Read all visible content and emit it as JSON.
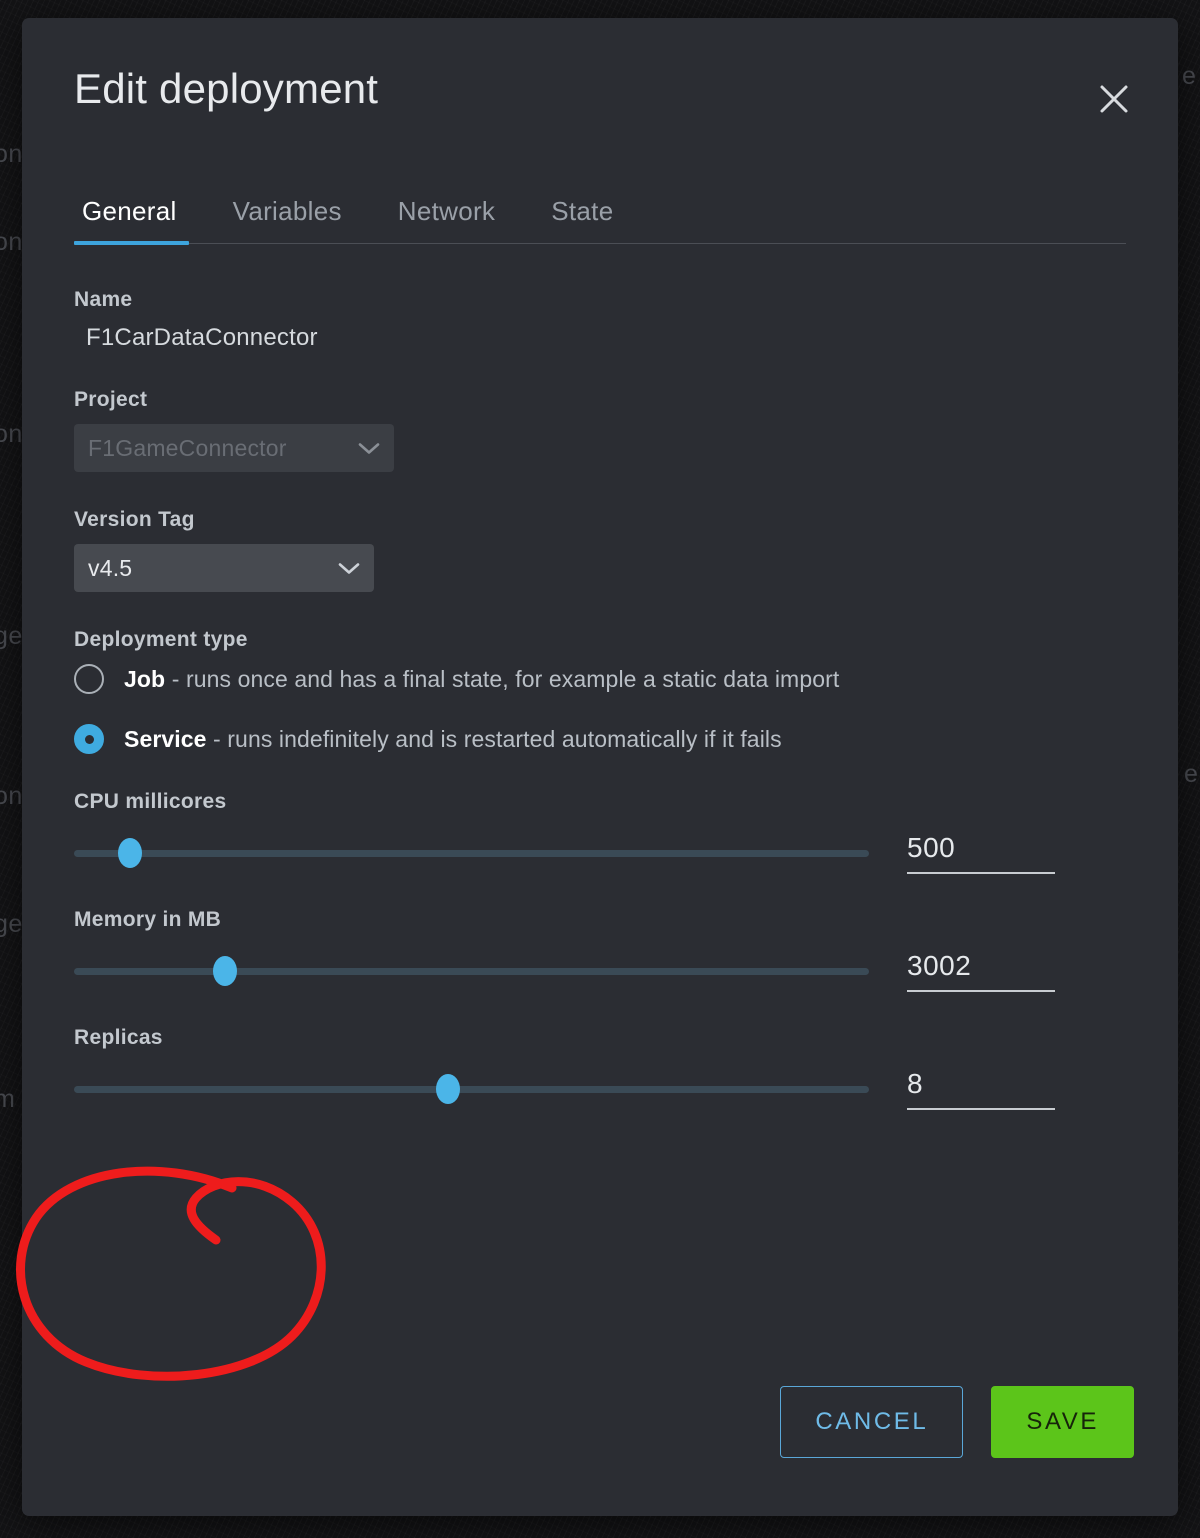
{
  "background": {
    "fragments": [
      "on",
      "on",
      "on",
      "ge",
      "on",
      "ge",
      "m",
      "e",
      "e"
    ]
  },
  "modal": {
    "title": "Edit deployment",
    "close_icon": "close-icon",
    "tabs": [
      {
        "label": "General",
        "active": true
      },
      {
        "label": "Variables",
        "active": false
      },
      {
        "label": "Network",
        "active": false
      },
      {
        "label": "State",
        "active": false
      }
    ],
    "fields": {
      "name": {
        "label": "Name",
        "value": "F1CarDataConnector"
      },
      "project": {
        "label": "Project",
        "value": "F1GameConnector",
        "disabled": true,
        "chevron_icon": "chevron-down-icon"
      },
      "version_tag": {
        "label": "Version Tag",
        "value": "v4.5",
        "disabled": false,
        "chevron_icon": "chevron-down-icon"
      },
      "deployment_type": {
        "label": "Deployment type",
        "options": [
          {
            "value": "job",
            "name": "Job",
            "description": " - runs once and has a final state, for example a static data import",
            "selected": false
          },
          {
            "value": "service",
            "name": "Service",
            "description": " - runs indefinitely and is restarted automatically if it fails",
            "selected": true
          }
        ]
      },
      "cpu": {
        "label": "CPU millicores",
        "value": "500",
        "thumb_percent": 7
      },
      "memory": {
        "label": "Memory in MB",
        "value": "3002",
        "thumb_percent": 19
      },
      "replicas": {
        "label": "Replicas",
        "value": "8",
        "thumb_percent": 47
      }
    },
    "buttons": {
      "cancel": "CANCEL",
      "save": "SAVE"
    }
  },
  "annotation": {
    "shape": "hand-drawn-red-circle",
    "target": "Replicas",
    "color": "#ee1c1c"
  },
  "colors": {
    "modal_bg": "#2b2d33",
    "accent_blue": "#3fabe0",
    "save_green": "#5cc51a",
    "slider_track": "#3a4a56",
    "annotation_red": "#ee1c1c"
  }
}
